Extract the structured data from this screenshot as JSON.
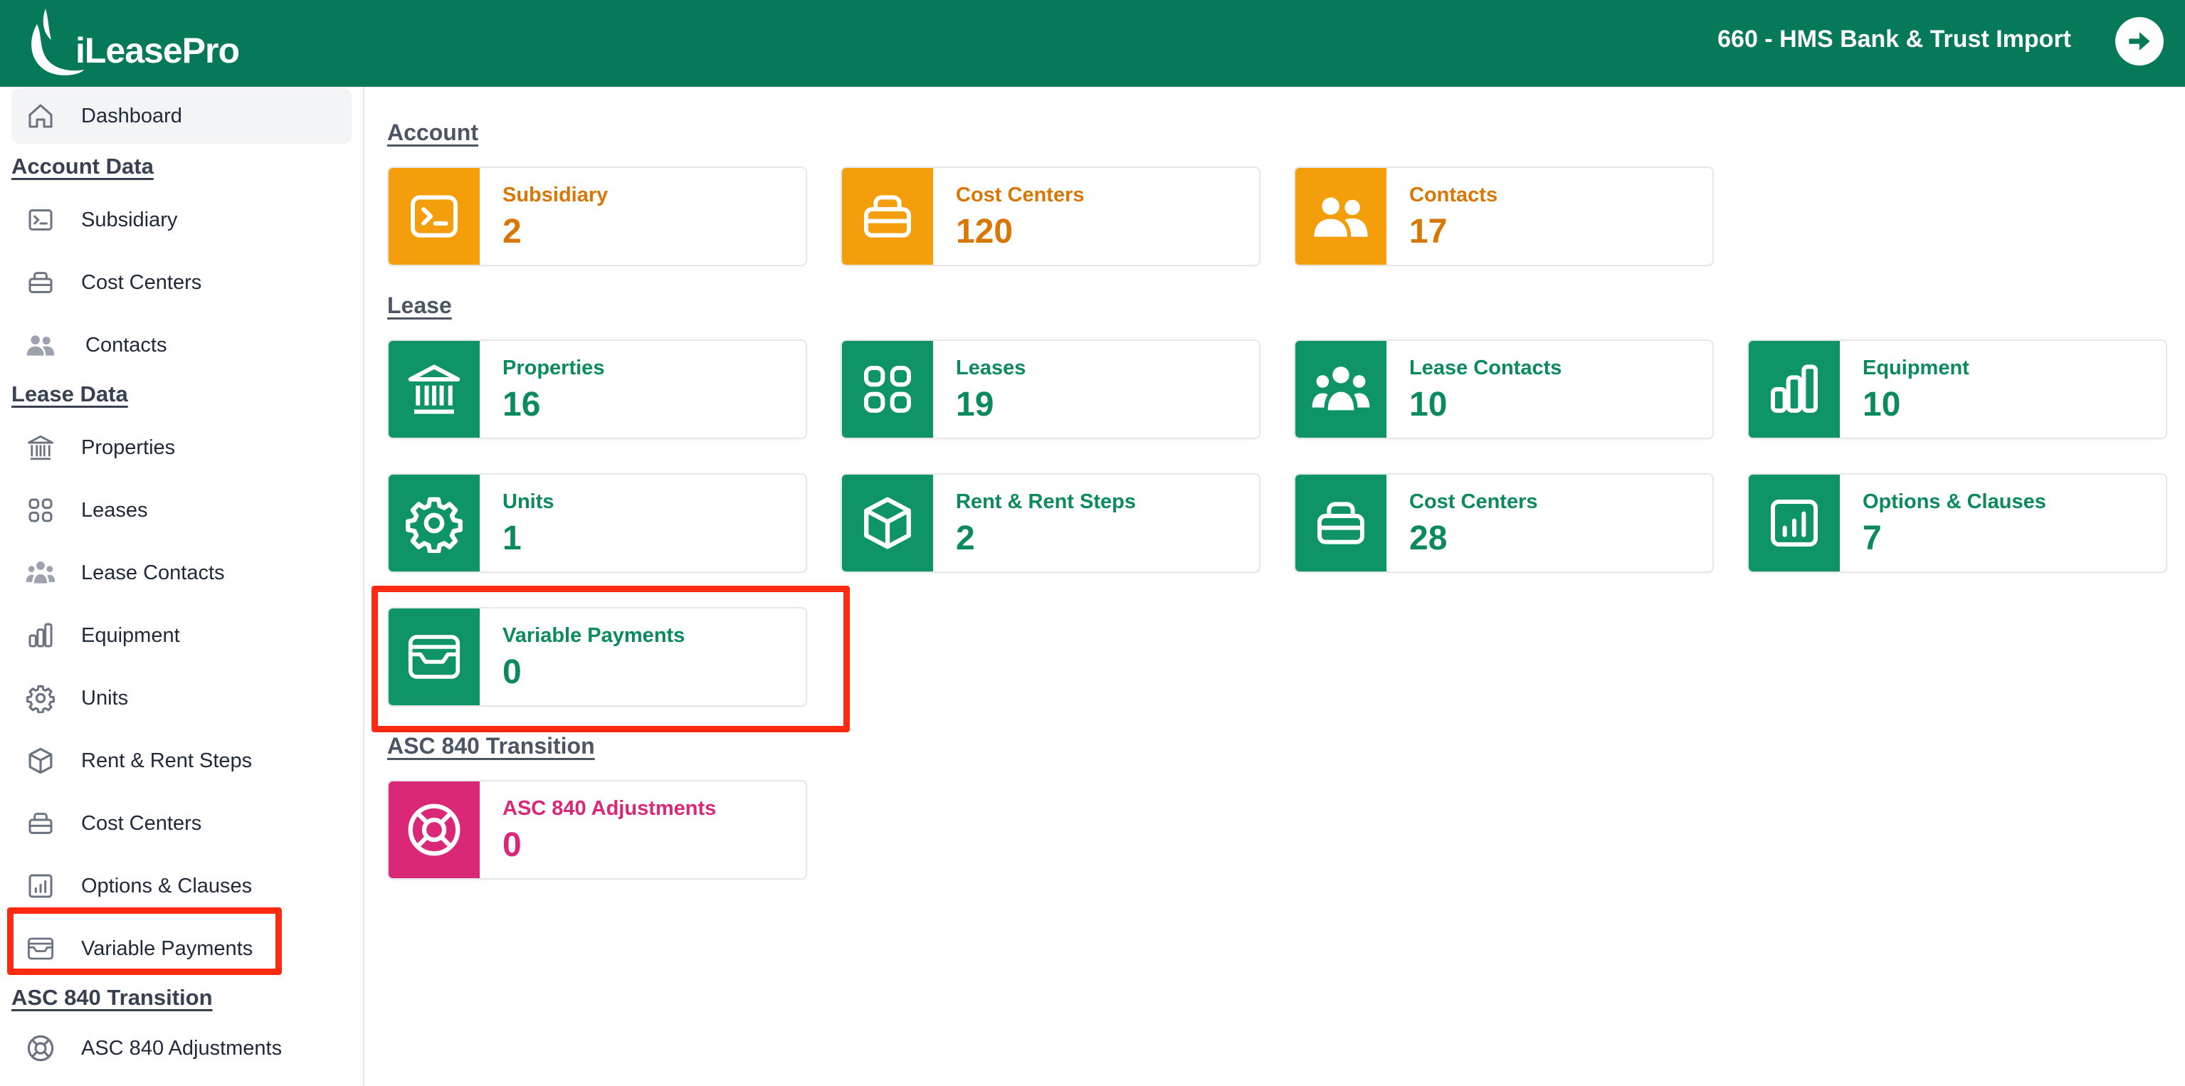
{
  "header": {
    "brand": "iLeasePro",
    "account_name": "660 - HMS Bank & Trust Import"
  },
  "sidebar": {
    "dashboard": "Dashboard",
    "account_heading": "Account Data",
    "account_items": [
      "Subsidiary",
      "Cost Centers",
      "Contacts"
    ],
    "lease_heading": "Lease Data",
    "lease_items": [
      "Properties",
      "Leases",
      "Lease Contacts",
      "Equipment",
      "Units",
      "Rent & Rent Steps",
      "Cost Centers",
      "Options & Clauses",
      "Variable Payments"
    ],
    "transition_heading": "ASC 840 Transition",
    "transition_items": [
      "ASC 840 Adjustments"
    ]
  },
  "main": {
    "account_title": "Account",
    "account_cards": [
      {
        "label": "Subsidiary",
        "value": "2",
        "icon": "terminal-icon"
      },
      {
        "label": "Cost Centers",
        "value": "120",
        "icon": "stack-icon"
      },
      {
        "label": "Contacts",
        "value": "17",
        "icon": "users-icon"
      }
    ],
    "lease_title": "Lease",
    "lease_cards": [
      {
        "label": "Properties",
        "value": "16",
        "icon": "bank-icon"
      },
      {
        "label": "Leases",
        "value": "19",
        "icon": "grid-icon"
      },
      {
        "label": "Lease Contacts",
        "value": "10",
        "icon": "user-group-icon"
      },
      {
        "label": "Equipment",
        "value": "10",
        "icon": "bar-chart-icon"
      },
      {
        "label": "Units",
        "value": "1",
        "icon": "gear-icon"
      },
      {
        "label": "Rent & Rent Steps",
        "value": "2",
        "icon": "cube-icon"
      },
      {
        "label": "Cost Centers",
        "value": "28",
        "icon": "stack-icon"
      },
      {
        "label": "Options & Clauses",
        "value": "7",
        "icon": "chart-box-icon"
      },
      {
        "label": "Variable Payments",
        "value": "0",
        "icon": "inbox-icon"
      }
    ],
    "transition_title": "ASC 840 Transition",
    "transition_cards": [
      {
        "label": "ASC 840 Adjustments",
        "value": "0",
        "icon": "lifebuoy-icon"
      }
    ]
  },
  "colors": {
    "header_bg": "#067a58",
    "account_accent": "#f59e0b",
    "lease_accent": "#0e9467",
    "transition_accent": "#db2777",
    "highlight": "#ff2a12"
  }
}
